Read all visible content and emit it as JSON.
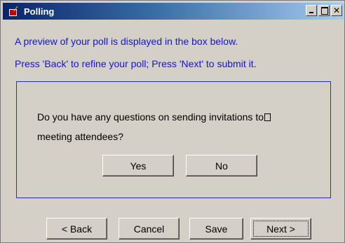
{
  "window": {
    "title": "Polling",
    "controls": {
      "minimize": "_",
      "maximize": "□",
      "close": "✕"
    }
  },
  "instructions": {
    "line1": "A preview of your poll is displayed in the box below.",
    "line2": "Press 'Back' to refine your poll; Press 'Next' to submit it."
  },
  "poll": {
    "question_line1": "Do you have any questions on sending invitations to",
    "question_line2": "meeting attendees?",
    "answers": [
      "Yes",
      "No"
    ]
  },
  "footer": {
    "back_label": "< Back",
    "cancel_label": "Cancel",
    "save_label": "Save",
    "next_label": "Next >"
  },
  "colors": {
    "instruction_text": "#1414d2",
    "preview_border": "#2a2ad8",
    "title_bar": "#0a246a",
    "window_bg": "#d4d0c8"
  },
  "icons": {
    "app": "poll-checkbox-icon"
  }
}
